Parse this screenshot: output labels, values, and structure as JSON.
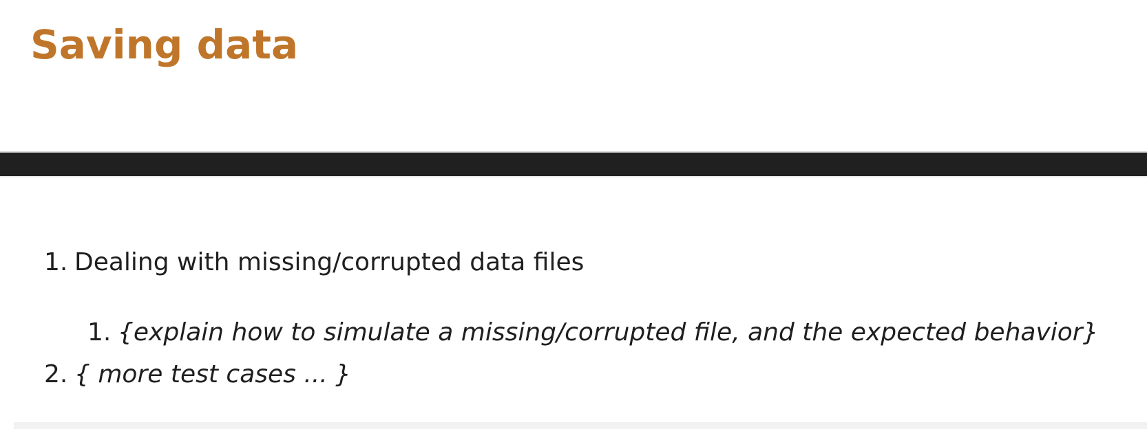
{
  "slide": {
    "title": "Saving data"
  },
  "list": {
    "item_1": {
      "number": "1.",
      "text": "Dealing with missing/corrupted data files"
    },
    "item_1_1": {
      "number": "1.",
      "text": "{explain how to simulate a missing/corrupted file, and the expected behavior}"
    },
    "item_2": {
      "number": "2.",
      "text": "{ more test cases ... }"
    }
  },
  "colors": {
    "title": "#c0762a",
    "rule": "#202020",
    "text": "#1f1f1f"
  }
}
